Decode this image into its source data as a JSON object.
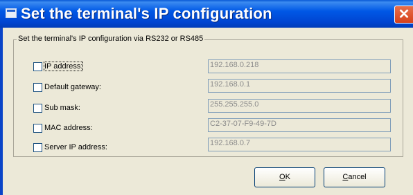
{
  "window": {
    "title": "Set the terminal's IP configuration",
    "close_glyph": "✕"
  },
  "group": {
    "legend": "Set the terminal's IP configuration via RS232 or RS485"
  },
  "rows": [
    {
      "label": "IP address:",
      "value": "192.168.0.218",
      "checked": false
    },
    {
      "label": "Default gateway:",
      "value": "192.168.0.1",
      "checked": false
    },
    {
      "label": "Sub mask:",
      "value": "255.255.255.0",
      "checked": false
    },
    {
      "label": "MAC address:",
      "value": "C2-37-07-F9-49-7D",
      "checked": false
    },
    {
      "label": "Server IP address:",
      "value": "192.168.0.7",
      "checked": false
    }
  ],
  "buttons": {
    "ok": {
      "mnemonic": "O",
      "rest": "K"
    },
    "cancel": {
      "mnemonic": "C",
      "rest": "ancel"
    }
  },
  "icons": {
    "title": "window-icon",
    "close": "close-icon"
  }
}
